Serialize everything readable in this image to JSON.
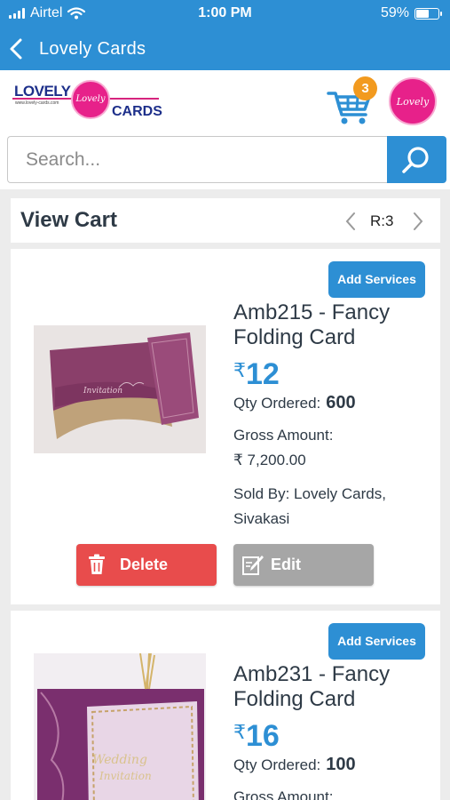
{
  "status_bar": {
    "carrier": "Airtel",
    "time": "1:00 PM",
    "battery": "59%",
    "battery_level": 0.59
  },
  "nav": {
    "title": "Lovely Cards"
  },
  "brand": {
    "logo_text_top": "LOVELY",
    "logo_url": "www.lovely-cards.com",
    "logo_text_bottom": "CARDS",
    "logo_emblem": "Lovely",
    "profile_emblem": "Lovely"
  },
  "cart": {
    "badge_count": "3"
  },
  "search": {
    "placeholder": "Search..."
  },
  "cart_header": {
    "title": "View Cart",
    "pager_label": "R:3"
  },
  "items": [
    {
      "add_services_label": "Add Services",
      "name": "Amb215 - Fancy Folding Card",
      "currency": "₹",
      "price": "12",
      "qty_label": "Qty Ordered:",
      "qty": "600",
      "gross_label": "Gross Amount:",
      "gross_value": "₹ 7,200.00",
      "sold_by": "Sold By:  Lovely Cards, Sivakasi",
      "delete_label": "Delete",
      "edit_label": "Edit"
    },
    {
      "add_services_label": "Add Services",
      "name": "Amb231 - Fancy Folding Card",
      "currency": "₹",
      "price": "16",
      "qty_label": "Qty Ordered:",
      "qty": "100",
      "gross_label": "Gross Amount:"
    }
  ],
  "colors": {
    "primary": "#2d8fd4",
    "badge": "#f29a1f",
    "delete": "#e84c4c",
    "edit": "#a6a6a6",
    "brand_pink": "#e7218a",
    "brand_navy": "#1d2f8a"
  }
}
